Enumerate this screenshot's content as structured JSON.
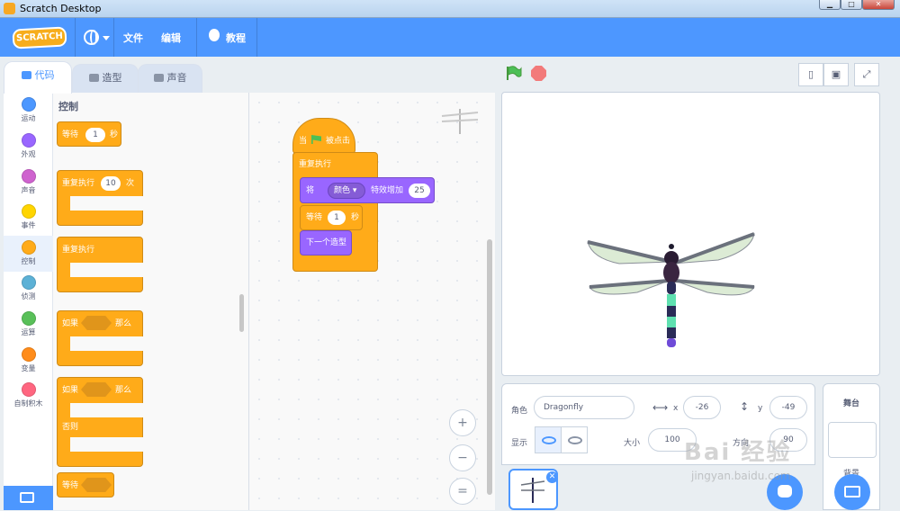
{
  "window": {
    "title": "Scratch Desktop"
  },
  "menubar": {
    "logo": "SCRATCH",
    "file": "文件",
    "edit": "编辑",
    "tutorials": "教程"
  },
  "tabs": [
    {
      "label": "代码"
    },
    {
      "label": "造型"
    },
    {
      "label": "声音"
    }
  ],
  "categories": [
    {
      "label": "运动",
      "color": "#4c97ff"
    },
    {
      "label": "外观",
      "color": "#9966ff"
    },
    {
      "label": "声音",
      "color": "#cf63cf"
    },
    {
      "label": "事件",
      "color": "#ffd500"
    },
    {
      "label": "控制",
      "color": "#ffab19"
    },
    {
      "label": "侦测",
      "color": "#5cb1d6"
    },
    {
      "label": "运算",
      "color": "#59c059"
    },
    {
      "label": "变量",
      "color": "#ff8c1a"
    },
    {
      "label": "自制积木",
      "color": "#ff6680"
    }
  ],
  "palette": {
    "title": "控制",
    "wait": {
      "label": "等待",
      "value": "1",
      "unit": "秒"
    },
    "repeat": {
      "label": "重复执行",
      "value": "10",
      "unit": "次"
    },
    "forever": {
      "label": "重复执行"
    },
    "if_then": {
      "label": "如果",
      "then": "那么"
    },
    "if_else": {
      "label": "如果",
      "then": "那么",
      "else": "否则"
    },
    "wait_until": {
      "label": "等待"
    }
  },
  "script": {
    "hat": {
      "prefix": "当",
      "suffix": "被点击"
    },
    "forever": "重复执行",
    "effect": {
      "label": "将",
      "dropdown": "颜色",
      "action": "特效增加",
      "value": "25"
    },
    "wait": {
      "label": "等待",
      "value": "1",
      "unit": "秒"
    },
    "next_costume": "下一个造型"
  },
  "zoom": {
    "in": "+",
    "out": "−",
    "reset": "="
  },
  "sprite_info": {
    "sprite_label": "角色",
    "sprite_name": "Dragonfly",
    "x_label": "x",
    "x_value": "-26",
    "y_label": "y",
    "y_value": "-49",
    "show_label": "显示",
    "size_label": "大小",
    "size_value": "100",
    "direction_label": "方向",
    "direction_value": "90"
  },
  "stage_pane": {
    "title": "舞台",
    "backdrops_label": "背景"
  },
  "watermark": {
    "main": "Bai 经验",
    "sub": "jingyan.baidu.com"
  },
  "colors": {
    "menubar": "#4d97ff",
    "control": "#ffab19",
    "looks": "#9966ff",
    "accent": "#4c97ff"
  }
}
